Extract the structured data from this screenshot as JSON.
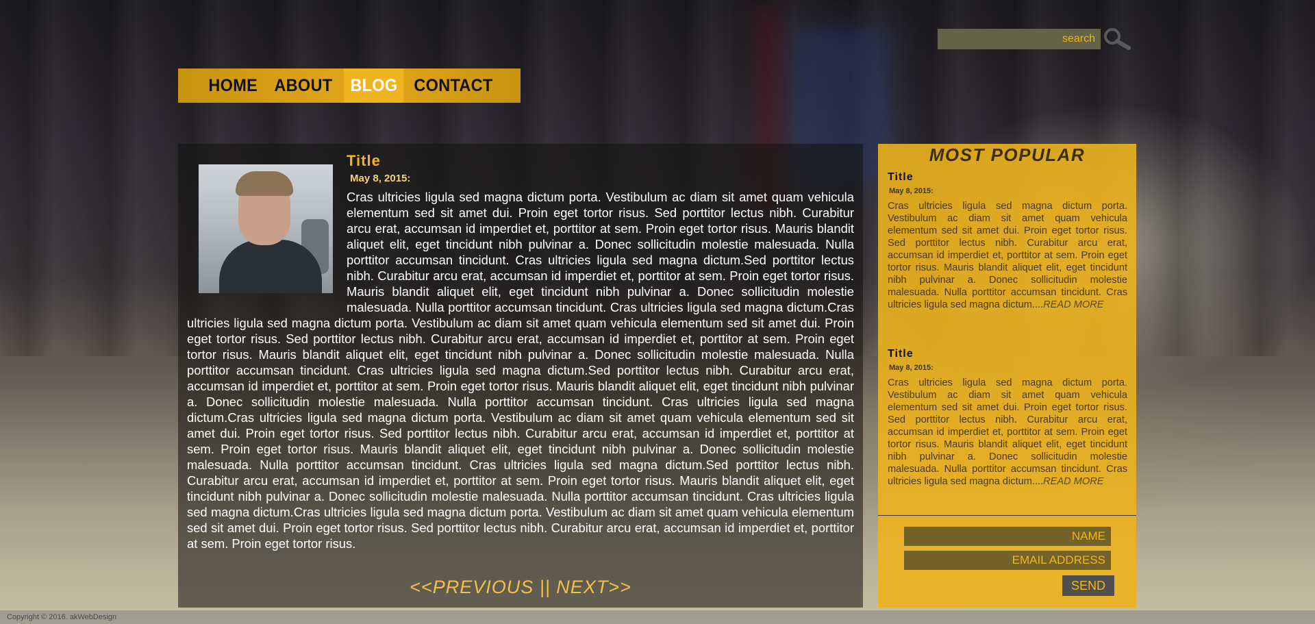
{
  "search": {
    "placeholder": "search"
  },
  "nav": {
    "items": [
      "HOME",
      "ABOUT",
      "BLOG",
      "CONTACT"
    ],
    "active": "BLOG"
  },
  "post": {
    "title": "Title",
    "date": "May 8, 2015:",
    "body": "Cras ultricies ligula sed magna dictum porta. Vestibulum ac diam sit amet quam vehicula elementum sed sit amet dui. Proin eget tortor risus. Sed porttitor lectus nibh. Curabitur arcu erat, accumsan id imperdiet et, porttitor at sem. Proin eget tortor risus. Mauris blandit aliquet elit, eget tincidunt nibh pulvinar a. Donec sollicitudin molestie malesuada. Nulla porttitor accumsan tincidunt. Cras ultricies ligula sed magna dictum.Sed porttitor lectus nibh. Curabitur arcu erat, accumsan id imperdiet et, porttitor at sem. Proin eget tortor risus. Mauris blandit aliquet elit, eget tincidunt nibh pulvinar a. Donec sollicitudin molestie malesuada. Nulla porttitor accumsan tincidunt. Cras ultricies ligula sed magna dictum.Cras ultricies ligula sed magna dictum porta. Vestibulum ac diam sit amet quam vehicula elementum sed sit amet dui. Proin eget tortor risus. Sed porttitor lectus nibh. Curabitur arcu erat, accumsan id imperdiet et, porttitor at sem. Proin eget tortor risus. Mauris blandit aliquet elit, eget tincidunt nibh pulvinar a. Donec sollicitudin molestie malesuada. Nulla porttitor accumsan tincidunt. Cras ultricies ligula sed magna dictum.Sed porttitor lectus nibh. Curabitur arcu erat, accumsan id imperdiet et, porttitor at sem. Proin eget tortor risus. Mauris blandit aliquet elit, eget tincidunt nibh pulvinar a. Donec sollicitudin molestie malesuada. Nulla porttitor accumsan tincidunt. Cras ultricies ligula sed magna dictum.Cras ultricies ligula sed magna dictum porta. Vestibulum ac diam sit amet quam vehicula elementum sed sit amet dui. Proin eget tortor risus. Sed porttitor lectus nibh. Curabitur arcu erat, accumsan id imperdiet et, porttitor at sem. Proin eget tortor risus. Mauris blandit aliquet elit, eget tincidunt nibh pulvinar a. Donec sollicitudin molestie malesuada. Nulla porttitor accumsan tincidunt. Cras ultricies ligula sed magna dictum.Sed porttitor lectus nibh. Curabitur arcu erat, accumsan id imperdiet et, porttitor at sem. Proin eget tortor risus. Mauris blandit aliquet elit, eget tincidunt nibh pulvinar a. Donec sollicitudin molestie malesuada. Nulla porttitor accumsan tincidunt. Cras ultricies ligula sed magna dictum.Cras ultricies ligula sed magna dictum porta. Vestibulum ac diam sit amet quam vehicula elementum sed sit amet dui. Proin eget tortor risus. Sed porttitor lectus nibh. Curabitur arcu erat, accumsan id imperdiet et, porttitor at sem. Proin eget tortor risus."
  },
  "pager": {
    "previous": "<<PREVIOUS",
    "separator": "||",
    "next": "NEXT>>"
  },
  "sidebar": {
    "heading": "MOST POPULAR",
    "items": [
      {
        "title": "Title",
        "date": "May 8, 2015:",
        "text": "Cras ultricies ligula sed magna dictum porta. Vestibulum ac diam sit amet quam vehicula elementum sed sit amet dui. Proin eget tortor risus. Sed porttitor lectus nibh. Curabitur arcu erat, accumsan id imperdiet et, porttitor at sem. Proin eget tortor risus. Mauris blandit aliquet elit, eget tincidunt nibh pulvinar a. Donec sollicitudin molestie malesuada. Nulla porttitor accumsan tincidunt. Cras ultricies ligula sed magna dictum....",
        "read_more": "READ MORE"
      },
      {
        "title": "Title",
        "date": "May 8, 2015:",
        "text": "Cras ultricies ligula sed magna dictum porta. Vestibulum ac diam sit amet quam vehicula elementum sed sit amet dui. Proin eget tortor risus. Sed porttitor lectus nibh. Curabitur arcu erat, accumsan id imperdiet et, porttitor at sem. Proin eget tortor risus. Mauris blandit aliquet elit, eget tincidunt nibh pulvinar a. Donec sollicitudin molestie malesuada. Nulla porttitor accumsan tincidunt. Cras ultricies ligula sed magna dictum....",
        "read_more": "READ MORE"
      }
    ]
  },
  "contact": {
    "name_placeholder": "NAME",
    "email_placeholder": "EMAIL ADDRESS",
    "send_label": "SEND"
  },
  "footer": {
    "copyright": "Copyright © 2016. akWebDesign"
  },
  "colors": {
    "accent": "#f2b51c",
    "nav_bg": "#e2a81c",
    "sidebar_bg": "#ecb21e",
    "main_bg": "#12120e"
  },
  "icons": {
    "search": "magnifier-icon"
  }
}
